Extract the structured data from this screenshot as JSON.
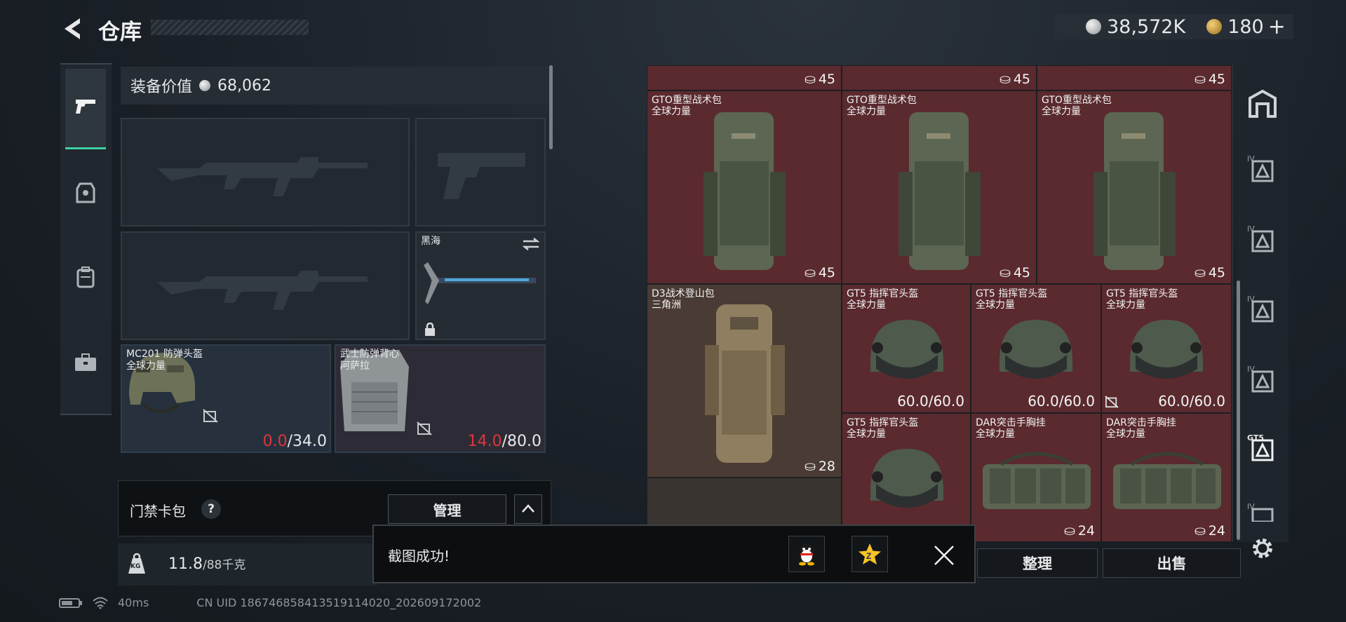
{
  "header": {
    "title": "仓库",
    "silver_amount": "38,572K",
    "gold_amount": "180",
    "gold_plus": "+"
  },
  "equipment": {
    "value_label": "装备价值",
    "value_amount": "68,062",
    "melee": {
      "name": "黑海"
    },
    "helmet": {
      "name": "MC201 防弹头盔",
      "source": "全球力量",
      "durability_current": "0.0",
      "durability_max": "/34.0"
    },
    "vest": {
      "name": "武士防弹背心",
      "source": "阿萨拉",
      "durability_current": "14.0",
      "durability_max": "/80.0"
    }
  },
  "keycard": {
    "label": "门禁卡包",
    "help": "?",
    "manage_label": "管理"
  },
  "weight": {
    "current": "11.8",
    "max": "/88千克",
    "icon_label": "KG"
  },
  "grid": {
    "top_counts": [
      "45",
      "45",
      "45"
    ],
    "backpacks": [
      {
        "name": "GTO重型战术包",
        "source": "全球力量",
        "count": "45"
      },
      {
        "name": "GTO重型战术包",
        "source": "全球力量",
        "count": "45"
      },
      {
        "name": "GTO重型战术包",
        "source": "全球力量",
        "count": "45"
      }
    ],
    "d3": {
      "name": "D3战术登山包",
      "source": "三角洲",
      "count": "28"
    },
    "helmets": [
      {
        "name": "GT5 指挥官头盔",
        "source": "全球力量",
        "durability": "60.0/60.0"
      },
      {
        "name": "GT5 指挥官头盔",
        "source": "全球力量",
        "durability": "60.0/60.0"
      },
      {
        "name": "GT5 指挥官头盔",
        "source": "全球力量",
        "durability": "60.0/60.0"
      },
      {
        "name": "GT5 指挥官头盔",
        "source": "全球力量"
      }
    ],
    "rigs": [
      {
        "name": "DAR突击手胸挂",
        "source": "全球力量",
        "count": "24"
      },
      {
        "name": "DAR突击手胸挂",
        "source": "全球力量",
        "count": "24"
      }
    ]
  },
  "actions": {
    "sort_label": "整理",
    "sell_label": "出售"
  },
  "toast": {
    "message": "截图成功!"
  },
  "sidebar": {
    "tier_labels": [
      "IV",
      "IV",
      "IV",
      "IV",
      "GT5",
      "IV"
    ]
  },
  "status": {
    "ping": "40ms",
    "uid": "CN UID 1867468584135191140​20_202609172002"
  },
  "colors": {
    "accent": "#3fd0a5",
    "warning_red": "#e0343a",
    "cell_red": "#5a2a2e",
    "cell_brown": "#4a3b34"
  }
}
